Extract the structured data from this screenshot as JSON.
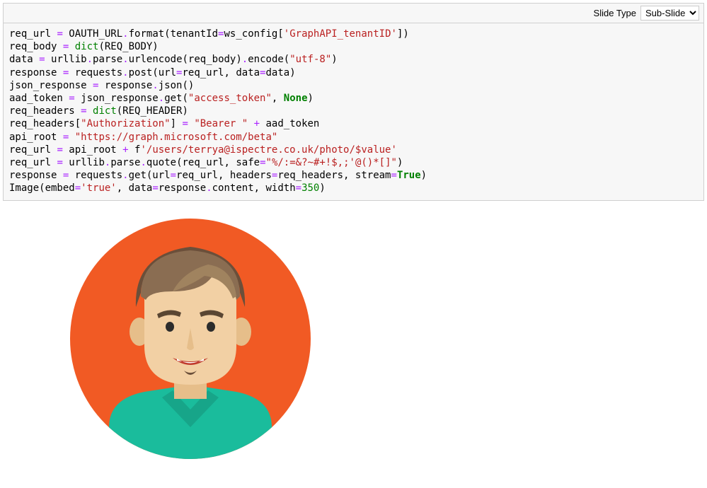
{
  "toolbar": {
    "slide_type_label": "Slide Type",
    "slide_type_selected": "Sub-Slide"
  },
  "code": {
    "l1": {
      "a": "req_url ",
      "op1": "=",
      "b": " OAUTH_URL",
      "op2": ".",
      "c": "format(tenantId",
      "op3": "=",
      "d": "ws_config[",
      "s": "'GraphAPI_tenantID'",
      "e": "])"
    },
    "l2": {
      "a": "req_body ",
      "op1": "=",
      "b": " ",
      "bi": "dict",
      "c": "(REQ_BODY)"
    },
    "l3": {
      "a": "data ",
      "op1": "=",
      "b": " urllib",
      "op2": ".",
      "c": "parse",
      "op3": ".",
      "d": "urlencode(req_body)",
      "op4": ".",
      "e": "encode(",
      "s": "\"utf-8\"",
      "f": ")"
    },
    "l4": {
      "a": "response ",
      "op1": "=",
      "b": " requests",
      "op2": ".",
      "c": "post(url",
      "op3": "=",
      "d": "req_url, data",
      "op4": "=",
      "e": "data)"
    },
    "l5": {
      "a": "json_response ",
      "op1": "=",
      "b": " response",
      "op2": ".",
      "c": "json()"
    },
    "l6": {
      "a": "aad_token ",
      "op1": "=",
      "b": " json_response",
      "op2": ".",
      "c": "get(",
      "s": "\"access_token\"",
      "d": ", ",
      "kw": "None",
      "e": ")"
    },
    "l7": {
      "a": "req_headers ",
      "op1": "=",
      "b": " ",
      "bi": "dict",
      "c": "(REQ_HEADER)"
    },
    "l8": {
      "a": "req_headers[",
      "s1": "\"Authorization\"",
      "b": "] ",
      "op1": "=",
      "c": " ",
      "s2": "\"Bearer \"",
      "d": " ",
      "op2": "+",
      "e": " aad_token"
    },
    "l9": {
      "a": "api_root ",
      "op1": "=",
      "b": " ",
      "s": "\"https://graph.microsoft.com/beta\""
    },
    "l10": {
      "a": "req_url ",
      "op1": "=",
      "b": " api_root ",
      "op2": "+",
      "c": " f",
      "s": "'/users/terrya@ispectre.co.uk/photo/$value'"
    },
    "l11": {
      "a": "req_url ",
      "op1": "=",
      "b": " urllib",
      "op2": ".",
      "c": "parse",
      "op3": ".",
      "d": "quote(req_url, safe",
      "op4": "=",
      "s": "\"%/:=&?~#+!$,;'@()*[]\"",
      "e": ")"
    },
    "l12": {
      "a": "response ",
      "op1": "=",
      "b": " requests",
      "op2": ".",
      "c": "get(url",
      "op3": "=",
      "d": "req_url, headers",
      "op4": "=",
      "e": "req_headers, stream",
      "op5": "=",
      "kw": "True",
      "f": ")"
    },
    "l13": {
      "a": "Image(embed",
      "op1": "=",
      "s": "'true'",
      "b": ", data",
      "op2": "=",
      "c": "response",
      "op3": ".",
      "d": "content, width",
      "op4": "=",
      "n": "350",
      "e": ")"
    }
  },
  "output": {
    "alt": "avatar-image"
  }
}
